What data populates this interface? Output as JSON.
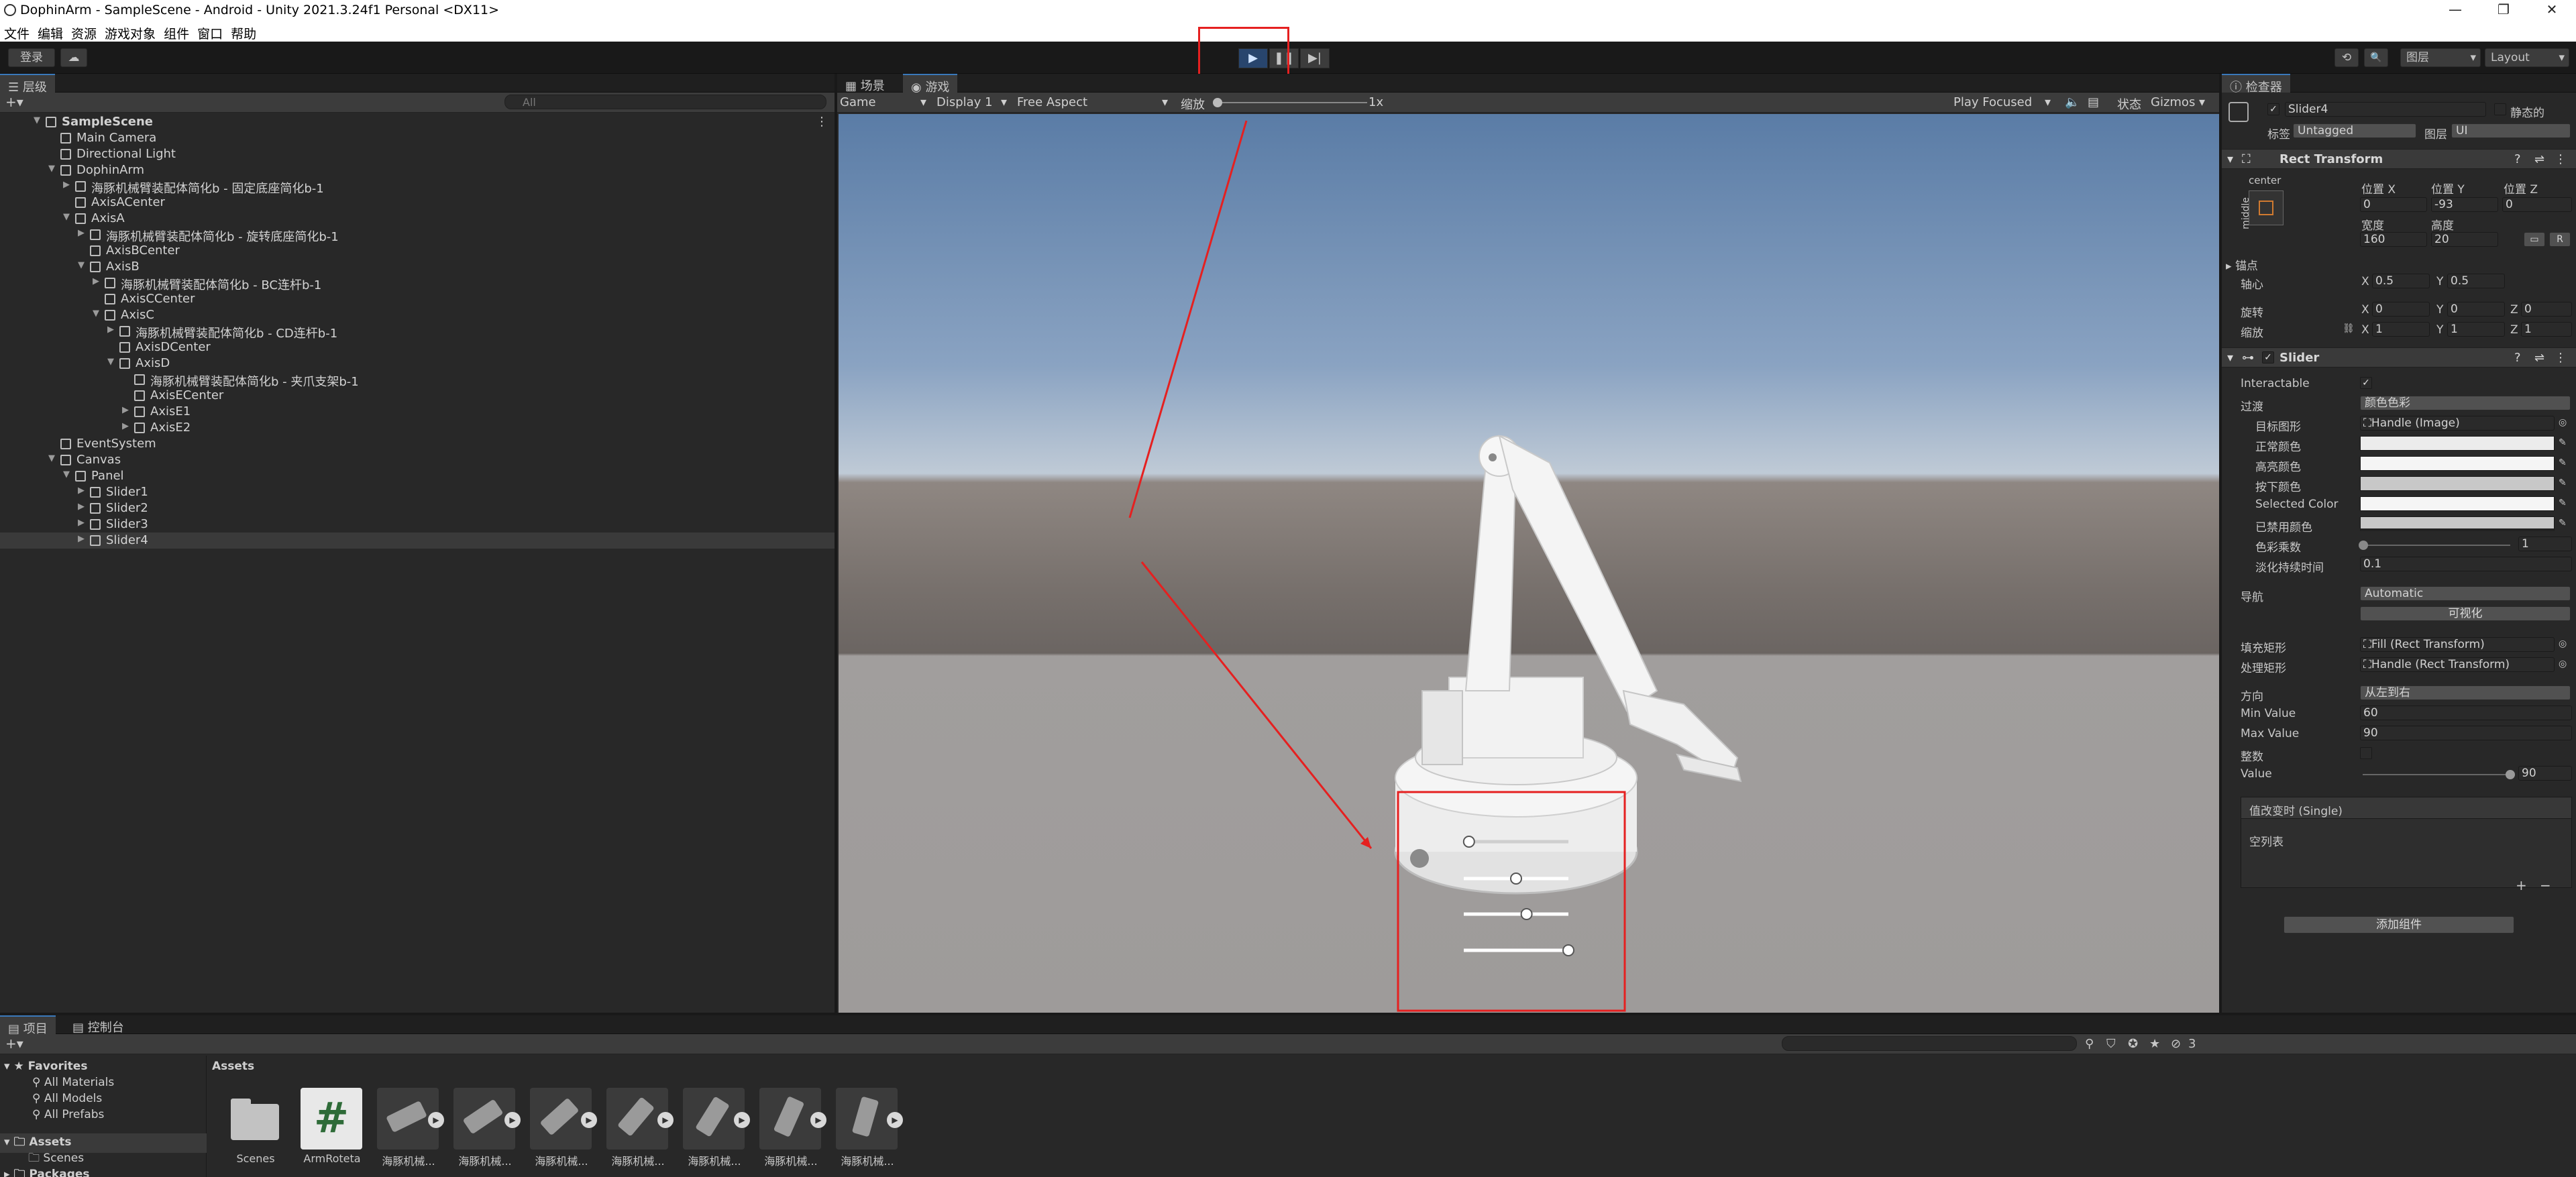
{
  "window": {
    "title": "DophinArm - SampleScene - Android - Unity 2021.3.24f1 Personal <DX11>",
    "minimize": "—",
    "maximize": "❐",
    "close": "✕"
  },
  "menu": [
    "文件",
    "编辑",
    "资源",
    "游戏对象",
    "组件",
    "窗口",
    "帮助"
  ],
  "toolbar": {
    "login": "登录",
    "cloud_icon": "☁",
    "play": "▶",
    "pause": "❚❚",
    "step": "▶|",
    "history_icon": "⟲",
    "search_icon": "🔍",
    "layers": "图层",
    "layout": "Layout"
  },
  "hierarchy": {
    "tab": "层级",
    "search_placeholder": "All",
    "items": [
      {
        "label": "SampleScene",
        "depth": 0,
        "arrow": "▼",
        "bold": true
      },
      {
        "label": "Main Camera",
        "depth": 1,
        "arrow": ""
      },
      {
        "label": "Directional Light",
        "depth": 1,
        "arrow": ""
      },
      {
        "label": "DophinArm",
        "depth": 1,
        "arrow": "▼"
      },
      {
        "label": "海豚机械臂装配体简化b - 固定底座简化b-1",
        "depth": 2,
        "arrow": "▶"
      },
      {
        "label": "AxisACenter",
        "depth": 2,
        "arrow": ""
      },
      {
        "label": "AxisA",
        "depth": 2,
        "arrow": "▼"
      },
      {
        "label": "海豚机械臂装配体简化b - 旋转底座简化b-1",
        "depth": 3,
        "arrow": "▶"
      },
      {
        "label": "AxisBCenter",
        "depth": 3,
        "arrow": ""
      },
      {
        "label": "AxisB",
        "depth": 3,
        "arrow": "▼"
      },
      {
        "label": "海豚机械臂装配体简化b - BC连杆b-1",
        "depth": 4,
        "arrow": "▶"
      },
      {
        "label": "AxisCCenter",
        "depth": 4,
        "arrow": ""
      },
      {
        "label": "AxisC",
        "depth": 4,
        "arrow": "▼"
      },
      {
        "label": "海豚机械臂装配体简化b - CD连杆b-1",
        "depth": 5,
        "arrow": "▶"
      },
      {
        "label": "AxisDCenter",
        "depth": 5,
        "arrow": ""
      },
      {
        "label": "AxisD",
        "depth": 5,
        "arrow": "▼"
      },
      {
        "label": "海豚机械臂装配体简化b - 夹爪支架b-1",
        "depth": 6,
        "arrow": ""
      },
      {
        "label": "AxisECenter",
        "depth": 6,
        "arrow": ""
      },
      {
        "label": "AxisE1",
        "depth": 6,
        "arrow": "▶"
      },
      {
        "label": "AxisE2",
        "depth": 6,
        "arrow": "▶"
      },
      {
        "label": "EventSystem",
        "depth": 1,
        "arrow": ""
      },
      {
        "label": "Canvas",
        "depth": 1,
        "arrow": "▼"
      },
      {
        "label": "Panel",
        "depth": 2,
        "arrow": "▼"
      },
      {
        "label": "Slider1",
        "depth": 3,
        "arrow": "▶"
      },
      {
        "label": "Slider2",
        "depth": 3,
        "arrow": "▶"
      },
      {
        "label": "Slider3",
        "depth": 3,
        "arrow": "▶"
      },
      {
        "label": "Slider4",
        "depth": 3,
        "arrow": "▶",
        "selected": true
      }
    ]
  },
  "game": {
    "tab_scene": "场景",
    "tab_game": "游戏",
    "mode": "Game",
    "display": "Display 1",
    "aspect": "Free Aspect",
    "scale_label": "缩放",
    "scale_value": "1x",
    "play_focused": "Play Focused",
    "stats": "状态",
    "gizmos": "Gizmos",
    "sliders": [
      0.05,
      0.5,
      0.6,
      1.0
    ]
  },
  "inspector": {
    "tab": "检查器",
    "object_name": "Slider4",
    "static_label": "静态的",
    "tag_label": "标签",
    "tag_value": "Untagged",
    "layer_label": "图层",
    "layer_value": "UI",
    "rect_transform": {
      "title": "Rect Transform",
      "anchor_preset": "center",
      "side_label": "middle",
      "pos_x_label": "位置 X",
      "pos_x": "0",
      "pos_y_label": "位置 Y",
      "pos_y": "-93",
      "pos_z_label": "位置 Z",
      "pos_z": "0",
      "width_label": "宽度",
      "width": "160",
      "height_label": "高度",
      "height": "20",
      "anchors_label": "锚点",
      "pivot_label": "轴心",
      "pivot_x": "0.5",
      "pivot_y": "0.5",
      "rotation_label": "旋转",
      "rot_x": "0",
      "rot_y": "0",
      "rot_z": "0",
      "scale_label": "缩放",
      "scale_x": "1",
      "scale_y": "1",
      "scale_z": "1",
      "blueprint_btn": "R"
    },
    "slider": {
      "title": "Slider",
      "interactable_label": "Interactable",
      "transition_label": "过渡",
      "transition_value": "颜色色彩",
      "target_graphic_label": "目标图形",
      "target_graphic_value": "Handle (Image)",
      "normal_color_label": "正常颜色",
      "highlight_color_label": "高亮颜色",
      "pressed_color_label": "按下颜色",
      "selected_color_label": "Selected Color",
      "disabled_color_label": "已禁用颜色",
      "color_multiplier_label": "色彩乘数",
      "color_multiplier_value": "1",
      "fade_label": "淡化持续时间",
      "fade_value": "0.1",
      "navigation_label": "导航",
      "navigation_value": "Automatic",
      "visualize_btn": "可视化",
      "fill_rect_label": "填充矩形",
      "fill_rect_value": "Fill (Rect Transform)",
      "handle_rect_label": "处理矩形",
      "handle_rect_value": "Handle (Rect Transform)",
      "direction_label": "方向",
      "direction_value": "从左到右",
      "min_label": "Min Value",
      "min_value": "60",
      "max_label": "Max Value",
      "max_value": "90",
      "whole_label": "整数",
      "value_label": "Value",
      "value_value": "90",
      "value_fraction": 1.0,
      "event_title": "值改变时 (Single)",
      "event_empty": "空列表",
      "plus": "+",
      "minus": "−"
    },
    "add_component": "添加组件"
  },
  "project": {
    "tab_project": "项目",
    "tab_console": "控制台",
    "favorites_label": "Favorites",
    "fav_items": [
      "All Materials",
      "All Models",
      "All Prefabs"
    ],
    "assets_label": "Assets",
    "scenes_label": "Scenes",
    "packages_label": "Packages",
    "breadcrumb": "Assets",
    "hidden_count": "3",
    "assets": [
      {
        "name": "Scenes",
        "kind": "folder"
      },
      {
        "name": "ArmRoteta",
        "kind": "script"
      },
      {
        "name": "海豚机械...",
        "kind": "model"
      },
      {
        "name": "海豚机械...",
        "kind": "model"
      },
      {
        "name": "海豚机械...",
        "kind": "model"
      },
      {
        "name": "海豚机械...",
        "kind": "model"
      },
      {
        "name": "海豚机械...",
        "kind": "model"
      },
      {
        "name": "海豚机械...",
        "kind": "model"
      },
      {
        "name": "海豚机械...",
        "kind": "model"
      }
    ]
  },
  "colors": {
    "accent": "#3a79bb",
    "annotation": "#e52020",
    "play_active": "#28456d"
  }
}
